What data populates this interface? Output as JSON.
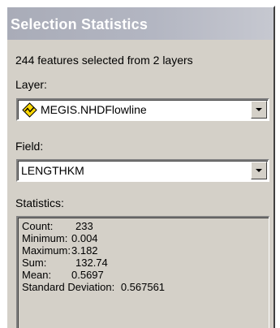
{
  "window": {
    "title": "Selection Statistics"
  },
  "summary": "244 features selected from 2 layers",
  "layer": {
    "label": "Layer:",
    "value": "MEGIS.NHDFlowline",
    "icon": "polyline-layer-icon",
    "icon_color": "#ffd800"
  },
  "field": {
    "label": "Field:",
    "value": "LENGTHKM"
  },
  "statistics": {
    "label": "Statistics:",
    "rows": [
      {
        "label": "Count:",
        "value": "233"
      },
      {
        "label": "Minimum:",
        "value": "0.004"
      },
      {
        "label": "Maximum:",
        "value": "3.182"
      },
      {
        "label": "Sum:",
        "value": "132.74"
      },
      {
        "label": "Mean:",
        "value": "0.5697"
      },
      {
        "label": "Standard Deviation:",
        "value": "0.567561"
      }
    ]
  }
}
